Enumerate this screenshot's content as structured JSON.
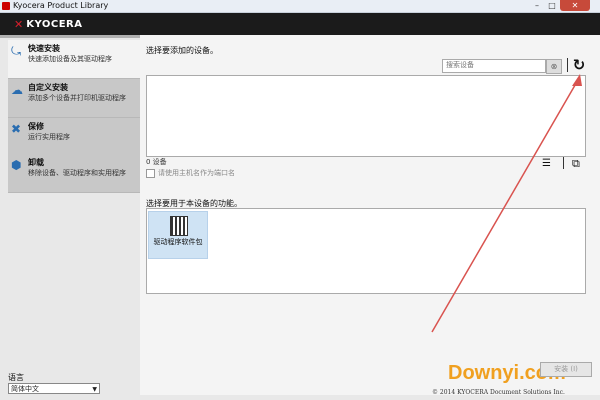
{
  "window": {
    "title": "Kyocera Product Library",
    "minimize": "–",
    "maximize": "□",
    "close": "✕"
  },
  "logo": {
    "mark": "✕",
    "text": "KYOCERA"
  },
  "sidebar": {
    "items": [
      {
        "title": "快速安装",
        "desc": "快速添加设备及其驱动程序",
        "icon": "quick-install-icon",
        "glyph": "⤿"
      },
      {
        "title": "自定义安装",
        "desc": "添加多个设备并打印机驱动程序",
        "icon": "custom-install-icon",
        "glyph": "☁"
      },
      {
        "title": "保修",
        "desc": "运行实用程序",
        "icon": "maintenance-icon",
        "glyph": "✖"
      },
      {
        "title": "卸载",
        "desc": "移除设备、驱动程序和实用程序",
        "icon": "uninstall-icon",
        "glyph": "⬢"
      }
    ]
  },
  "main": {
    "device_section_label": "选择要添加的设备。",
    "search_placeholder": "搜索设备",
    "search_button": "⊗",
    "refresh_glyph": "↻",
    "device_count": "0 设备",
    "hostname_checkbox": "请使用主机名作为端口名",
    "list_view_glyph": "☰",
    "tile_view_glyph": "⧉",
    "function_section_label": "选择要用于本设备的功能。",
    "function_tile_label": "驱动程序软件包",
    "install_button": "安装 (I)"
  },
  "language": {
    "label": "语言",
    "selected": "简体中文",
    "arrow": "▼"
  },
  "footer": {
    "copyright": "© 2014 KYOCERA Document Solutions Inc."
  },
  "watermark": "Downyi.com",
  "colors": {
    "accent": "#d61f2c",
    "header_bg": "#1b1b1b",
    "arrow": "#d9534f",
    "watermark": "#f0a020"
  }
}
